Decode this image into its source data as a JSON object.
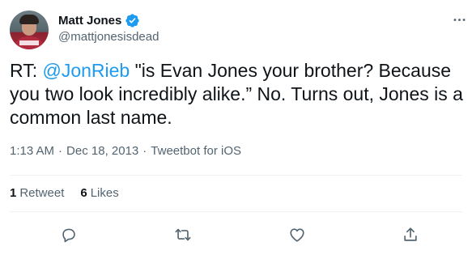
{
  "author": {
    "display_name": "Matt Jones",
    "handle": "@mattjonesisdead",
    "verified": true
  },
  "tweet": {
    "prefix": "RT: ",
    "mention": "@JonRieb",
    "text_after_mention": " \"is Evan Jones your brother? Because you two look incredibly alike.” No. Turns out, Jones is a common last name."
  },
  "meta": {
    "time": "1:13 AM",
    "separator1": "·",
    "date": "Dec 18, 2013",
    "separator2": "·",
    "source": "Tweetbot for iOS"
  },
  "stats": {
    "retweets_count": "1",
    "retweets_label": "Retweet",
    "likes_count": "6",
    "likes_label": "Likes"
  },
  "icons": {
    "verified": "verified-badge-icon",
    "more": "more-options-icon",
    "reply": "reply-icon",
    "retweet": "retweet-icon",
    "like": "heart-icon",
    "share": "share-icon"
  },
  "colors": {
    "accent": "#1d9bf0",
    "text": "#0f1419",
    "secondary": "#536471",
    "divider": "#eff3f4"
  }
}
